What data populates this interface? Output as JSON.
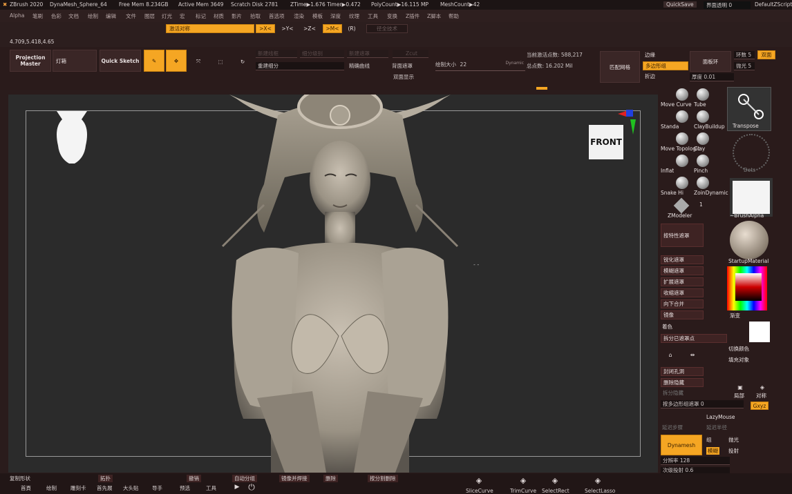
{
  "titlebar": {
    "app": "ZBrush 2020",
    "doc": "DynaMesh_Sphere_64",
    "free_mem": "Free Mem 8.234GB",
    "active_mem": "Active Mem 3649",
    "scratch": "Scratch Disk 2781",
    "ztime": "ZTime▶1.676 Timer▶0.472",
    "polycount": "PolyCount▶16.115 MP",
    "meshcount": "MeshCount▶42",
    "quicksave": "QuickSave",
    "transparency": "界面透明 0",
    "default_script": "DefaultZScript"
  },
  "menu": [
    "Alpha",
    "笔刷",
    "色彩",
    "文档",
    "绘制",
    "编辑",
    "文件",
    "图层",
    "灯光",
    "宏",
    "标记",
    "材质",
    "影片",
    "拾取",
    "首选项",
    "渲染",
    "模板",
    "深度",
    "纹理",
    "工具",
    "变换",
    "Z插件",
    "Z脚本",
    "帮助"
  ],
  "symmetry": {
    "activate_label": "激活对称",
    "x": ">X<",
    "y": ">Y<",
    "z": ">Z<",
    "m": ">M<",
    "r": "(R)",
    "radial": "径全技术"
  },
  "coords": "4.709,5.418,4.65",
  "toolbar": {
    "projection_master": "Projection Master",
    "lightbox": "灯箱",
    "quick_sketch": "Quick Sketch",
    "edit": "Edit",
    "draw": "绘制",
    "move": "移动",
    "scale": "缩放",
    "rotate": "旋转",
    "gray1": "新建线框",
    "gray2": "细分级别",
    "gray3": "新建遮罩",
    "zcut": "Zcut",
    "rebuild": "重建细分",
    "smooth_curve": "精确曲线",
    "resubdivide": "背面遮罩",
    "double_sided": "双面显示",
    "draw_size_label": "绘制大小",
    "draw_size_value": "22",
    "dynamic": "Dynamic",
    "active_points": "当前激活点数: 588,217",
    "total_points": "总点数: 16.202 Mil",
    "match_mesh": "匹配网格",
    "edge_loop": "边缘",
    "polygroup": "多边形组",
    "border": "折边",
    "panel_loops": "面板环",
    "loops": "环数",
    "loops_val": "5",
    "double": "双面",
    "polish": "抛光",
    "polish_val": "5",
    "thickness": "厚度",
    "thickness_val": "0.01"
  },
  "viewport": {
    "front_label": "FRONT"
  },
  "brushes": [
    {
      "name": "Move Curve",
      "name2": "Tube"
    },
    {
      "name": "Standa",
      "name2": "ClayBuildup"
    },
    {
      "name": "Move Topologic",
      "name2": "Clay"
    },
    {
      "name": "Inflat",
      "name2": "Pinch"
    },
    {
      "name": "Snake Hi",
      "name2": "ZoinDynamic"
    }
  ],
  "right": {
    "transpose": "Transpose",
    "dots": "Dots",
    "brush_alpha": "~BrushAlpha",
    "zmodeler": "ZModeler",
    "one": "1",
    "startup_material": "StartupMaterial",
    "gradient": "渐变",
    "main_color": "着色",
    "masks": [
      "按特性遮罩",
      "锐化遮罩",
      "模糊遮罩",
      "扩展遮罩",
      "收缩遮罩",
      "向下合并",
      "镜像"
    ],
    "split_masked": "拆分已遮罩点",
    "switch_color": "切换颜色",
    "fill_object": "填充对象",
    "close_holes": "封闭孔洞",
    "del_hidden": "删除隐藏",
    "split_unmasked": "拆分隐藏",
    "group_by_mask": "按多边形组遮罩 0",
    "lazymouse": "LazyMouse",
    "lazy_step": "延迟步骤",
    "lazy_radius": "延迟半径",
    "dynamesh": "Dynamesh",
    "group": "组",
    "project": "投射",
    "blur": "模糊",
    "polish": "抛光",
    "resolution": "分辨率 128",
    "subproj": "次级投射 0.6",
    "xyz": "Gxyz",
    "local": "局部",
    "sym": "对称"
  },
  "bottom": {
    "items": [
      "复制形状",
      "拓扑",
      "撤销",
      "自动分组",
      "镜像并焊接",
      "删除",
      "按分割删除"
    ],
    "tabs": [
      "首頁",
      "绘制",
      "雕刻卡",
      "首先展",
      "大头贴",
      "导手",
      "预选",
      "工具"
    ],
    "tools": [
      "SliceCurve",
      "TrimCurve",
      "SelectRect",
      "SelectLasso"
    ]
  },
  "colors": {
    "accent": "#f5a623",
    "panel": "#2a1b1b",
    "viewport": "#2b2b2b"
  }
}
